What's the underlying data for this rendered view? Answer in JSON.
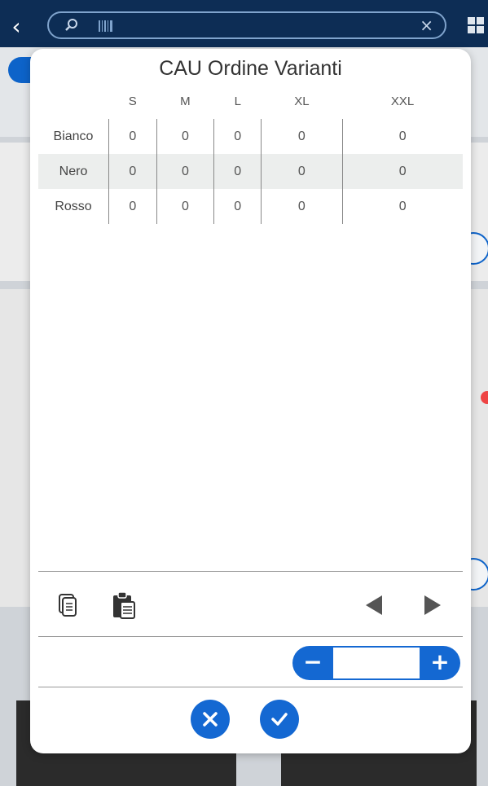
{
  "search": {
    "placeholder": "",
    "clear": "×"
  },
  "modal": {
    "title": "CAU Ordine Varianti",
    "sizes": [
      "S",
      "M",
      "L",
      "XL",
      "XXL"
    ],
    "rows": [
      {
        "color": "Bianco",
        "values": [
          "0",
          "0",
          "0",
          "0",
          "0"
        ]
      },
      {
        "color": "Nero",
        "values": [
          "0",
          "0",
          "0",
          "0",
          "0"
        ]
      },
      {
        "color": "Rosso",
        "values": [
          "0",
          "0",
          "0",
          "0",
          "0"
        ]
      }
    ],
    "quantity": {
      "minus": "−",
      "plus": "+",
      "value": ""
    }
  },
  "colors": {
    "accent": "#1468d2",
    "topbar": "#0d2d55"
  }
}
